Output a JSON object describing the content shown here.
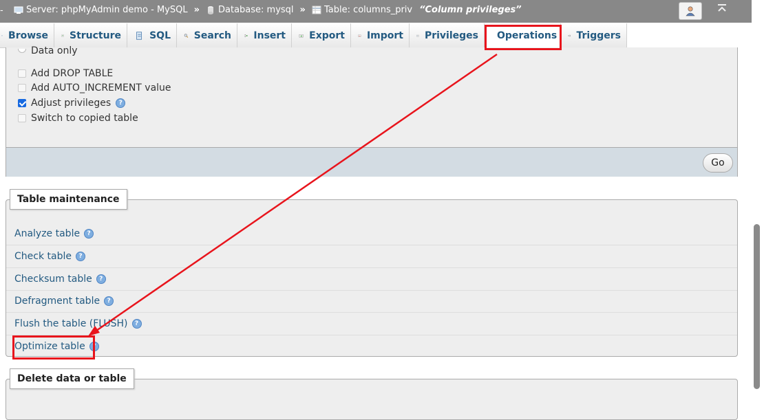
{
  "breadcrumb": {
    "server": "Server: phpMyAdmin demo - MySQL",
    "database": "Database: mysql",
    "table": "Table: columns_priv",
    "comment": "“Column privileges”",
    "separator": "»"
  },
  "tabs": [
    {
      "label": "Browse",
      "icon": "browse-icon"
    },
    {
      "label": "Structure",
      "icon": "structure-icon"
    },
    {
      "label": "SQL",
      "icon": "sql-icon"
    },
    {
      "label": "Search",
      "icon": "search-icon"
    },
    {
      "label": "Insert",
      "icon": "insert-icon"
    },
    {
      "label": "Export",
      "icon": "export-icon"
    },
    {
      "label": "Import",
      "icon": "import-icon"
    },
    {
      "label": "Privileges",
      "icon": "privileges-icon"
    },
    {
      "label": "Operations",
      "icon": "wrench-icon"
    },
    {
      "label": "Triggers",
      "icon": "triggers-icon"
    }
  ],
  "copy_options": {
    "data_only": "Data only",
    "add_drop_table": "Add DROP TABLE",
    "add_auto_increment": "Add AUTO_INCREMENT value",
    "adjust_privileges": "Adjust privileges",
    "switch_to_copied": "Switch to copied table",
    "go_label": "Go"
  },
  "maintenance": {
    "legend": "Table maintenance",
    "items": [
      "Analyze table",
      "Check table",
      "Checksum table",
      "Defragment table",
      "Flush the table (FLUSH)",
      "Optimize table"
    ]
  },
  "delete_section": {
    "legend": "Delete data or table"
  },
  "colors": {
    "link": "#235a81",
    "annotation": "#e8141c",
    "topbar": "#888888"
  }
}
